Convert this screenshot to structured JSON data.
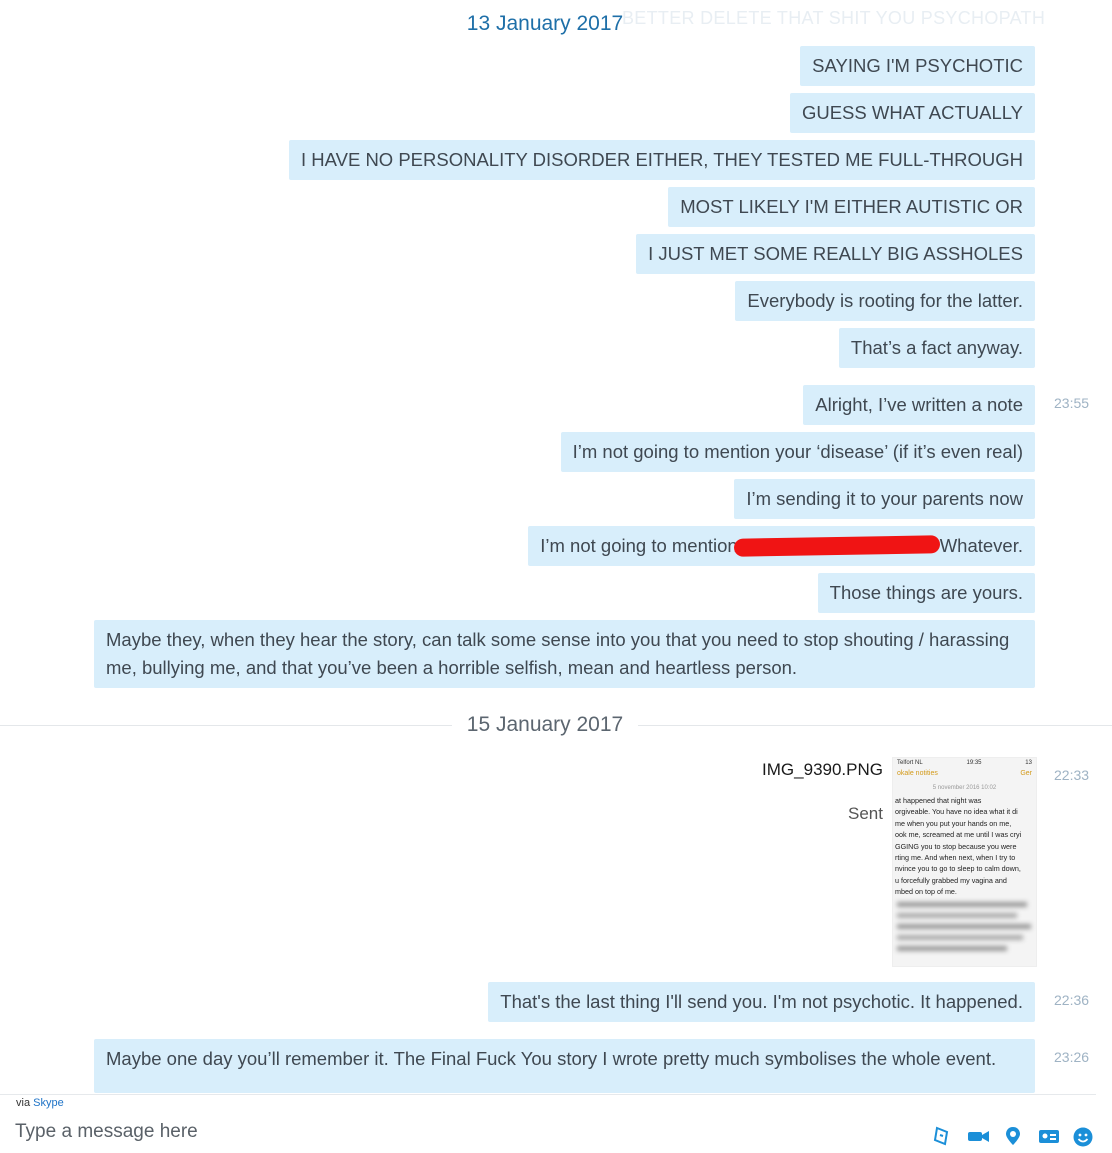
{
  "conversation": {
    "ghost_text": "BETTER DELETE THAT SHIT YOU PSYCHOPATH",
    "date1": "13 January 2017",
    "date2": "15 January 2017",
    "messages": [
      "SAYING I'M PSYCHOTIC",
      "GUESS WHAT ACTUALLY",
      "I HAVE NO PERSONALITY DISORDER EITHER, THEY TESTED ME FULL-THROUGH",
      "MOST LIKELY I'M EITHER AUTISTIC OR",
      "I JUST MET SOME REALLY BIG ASSHOLES",
      "Everybody is rooting for the latter.",
      "That’s a fact anyway.",
      "Alright, I’ve written a note",
      "I’m not going to mention your ‘disease’ (if it’s even real)",
      "I’m sending it to your parents now",
      "I’m not going to mention",
      "Those things are yours.",
      "Maybe they, when they hear the story, can talk some sense into you that you need to stop shouting / harassing me, bullying me, and that you’ve been a horrible selfish, mean and heartless person.",
      "That's the last thing I'll send you. I'm not psychotic. It happened.",
      "Maybe one day you’ll remember it. The Final Fuck You story I wrote pretty much symbolises the whole event."
    ],
    "redacted_suffix": "Whatever.",
    "times": [
      "23:55",
      "22:33",
      "22:36",
      "23:26"
    ],
    "attachment": {
      "file_name": "IMG_9390.PNG",
      "status": "Sent",
      "thumb": {
        "carrier": "Telfort NL",
        "clock": "19:35",
        "battery": "13",
        "title": "okale notities",
        "title_right": "Ger",
        "date": "5 november 2016 10:02",
        "lines": [
          "at happened that night was",
          "orgiveable. You have no idea what it di",
          "me when you put your hands on me,",
          "ook me, screamed at me until I was cryi",
          "GGING you to stop because you were",
          "rting me. And when next, when I try to",
          "nvince you to go to sleep to calm down,",
          "u forcefully grabbed my vagina and",
          "mbed on top of me."
        ]
      }
    }
  },
  "footer": {
    "via_prefix": "via",
    "via_link": "Skype",
    "composer_placeholder": "Type a message here"
  },
  "tool_icons": [
    "send-file-icon",
    "video-message-icon",
    "location-icon",
    "contact-card-icon",
    "emoticon-icon"
  ]
}
